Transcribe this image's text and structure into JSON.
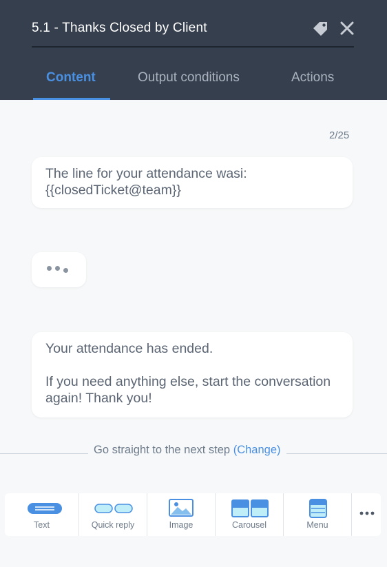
{
  "header": {
    "title": "5.1 - Thanks Closed by Client",
    "tabs": [
      {
        "label": "Content",
        "active": true
      },
      {
        "label": "Output conditions",
        "active": false
      },
      {
        "label": "Actions",
        "active": false
      }
    ]
  },
  "content": {
    "counter": "2/25",
    "bubbles": [
      {
        "lines": [
          "The line for your attendance wasi:",
          "{{closedTicket@team}}"
        ]
      },
      {
        "lines": [
          "Your attendance has ended.",
          "",
          "If you need anything else, start the conversation",
          "again! Thank you!"
        ]
      }
    ]
  },
  "next_step": {
    "text": "Go straight to the next step",
    "link": "(Change)"
  },
  "toolbar": {
    "items": [
      {
        "label": "Text",
        "icon": "text-icon"
      },
      {
        "label": "Quick reply",
        "icon": "quick-reply-icon"
      },
      {
        "label": "Image",
        "icon": "image-icon"
      },
      {
        "label": "Carousel",
        "icon": "carousel-icon"
      },
      {
        "label": "Menu",
        "icon": "menu-icon"
      }
    ],
    "more_icon": "more-icon"
  },
  "colors": {
    "header_bg": "#363f4d",
    "accent": "#4a90e2",
    "page_bg": "#f6f8f9"
  }
}
